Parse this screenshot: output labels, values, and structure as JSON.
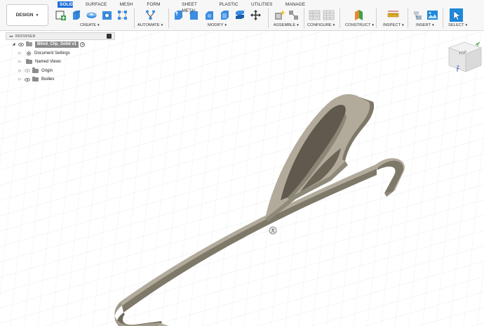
{
  "workspace": {
    "label": "DESIGN"
  },
  "tabs": [
    {
      "label": "SOLID",
      "active": true
    },
    {
      "label": "SURFACE"
    },
    {
      "label": "MESH"
    },
    {
      "label": "FORM"
    },
    {
      "label": "SHEET METAL"
    },
    {
      "label": "PLASTIC"
    },
    {
      "label": "UTILITIES"
    },
    {
      "label": "MANAGE"
    }
  ],
  "groups": {
    "create": "CREATE",
    "automate": "AUTOMATE",
    "modify": "MODIFY",
    "assemble": "ASSEMBLE",
    "configure": "CONFIGURE",
    "construct": "CONSTRUCT",
    "inspect": "INSPECT",
    "insert": "INSERT",
    "select": "SELECT"
  },
  "browser": {
    "title": "BROWSER",
    "root": "Blind_Clip_Solid v1",
    "items": [
      {
        "label": "Document Settings"
      },
      {
        "label": "Named Views"
      },
      {
        "label": "Origin"
      },
      {
        "label": "Bodies"
      }
    ]
  },
  "viewcube": {
    "face": "TOP",
    "axis_z": "Z",
    "axis_y": "Y"
  },
  "colors": {
    "accent": "#1e6fd9",
    "model_top": "#b2ab9c",
    "model_side": "#7e7868",
    "grid": "#d6dde3"
  }
}
